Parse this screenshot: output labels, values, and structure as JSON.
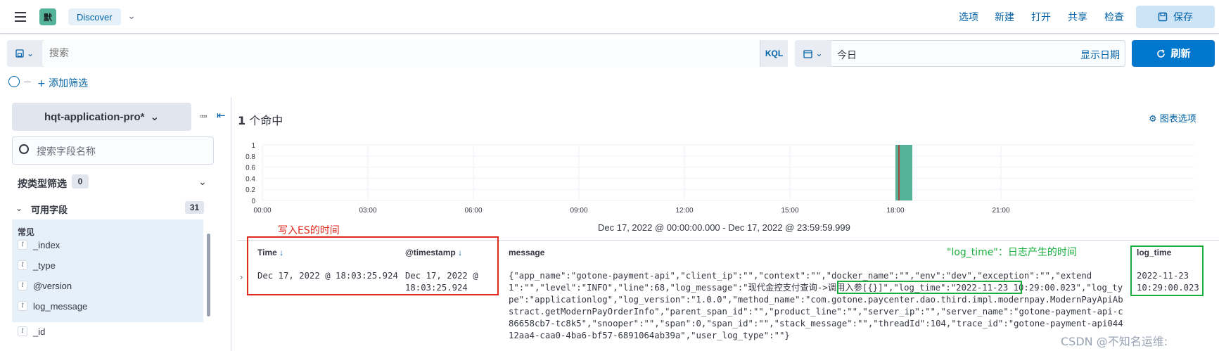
{
  "header": {
    "space_initial": "默",
    "breadcrumb": "Discover",
    "links": [
      "选项",
      "新建",
      "打开",
      "共享",
      "检查"
    ],
    "save_label": "保存"
  },
  "query": {
    "placeholder": "搜索",
    "language": "KQL",
    "date_value": "今日",
    "show_dates": "显示日期",
    "refresh_label": "刷新",
    "add_filter": "+ 添加筛选"
  },
  "sidebar": {
    "index_pattern": "hqt-application-pro*",
    "field_search_placeholder": "搜索字段名称",
    "type_filter_label": "按类型筛选",
    "type_filter_count": "0",
    "available_label": "可用字段",
    "available_count": "31",
    "common_label": "常见",
    "fields": [
      {
        "type": "t",
        "name": "_index"
      },
      {
        "type": "t",
        "name": "_type"
      },
      {
        "type": "t",
        "name": "@version"
      },
      {
        "type": "t",
        "name": "log_message"
      },
      {
        "type": "t",
        "name": "_id"
      }
    ]
  },
  "main": {
    "hits_count": "1",
    "hits_label": "个命中",
    "chart_options": "图表选项",
    "range_label": "Dec 17, 2022 @ 00:00:00.000 - Dec 17, 2022 @ 23:59:59.999"
  },
  "chart_data": {
    "type": "bar",
    "x_ticks": [
      "00:00",
      "03:00",
      "06:00",
      "09:00",
      "12:00",
      "15:00",
      "18:00",
      "21:00"
    ],
    "y_ticks": [
      "1",
      "0.8",
      "0.6",
      "0.4",
      "0.2",
      "0"
    ],
    "ylim": [
      0,
      1
    ],
    "bars": [
      {
        "x": "18:00",
        "value": 1
      }
    ],
    "bar_color": "#54b399"
  },
  "table": {
    "columns": [
      {
        "label": "Time",
        "sort": "↓"
      },
      {
        "label": "@timestamp",
        "sort": "↓"
      },
      {
        "label": "message",
        "sort": ""
      },
      {
        "label": "log_time",
        "sort": ""
      }
    ],
    "row": {
      "time": "Dec 17, 2022 @ 18:03:25.924",
      "timestamp": "Dec 17, 2022 @ 18:03:25.924",
      "message": "{\"app_name\":\"gotone-payment-api\",\"client_ip\":\"\",\"context\":\"\",\"docker_name\":\"\",\"env\":\"dev\",\"exception\":\"\",\"extend1\":\"\",\"level\":\"INFO\",\"line\":68,\"log_message\":\"现代金控支付查询->调用入参[{}]\",\"log_time\":\"2022-11-23 10:29:00.023\",\"log_type\":\"applicationlog\",\"log_version\":\"1.0.0\",\"method_name\":\"com.gotone.paycenter.dao.third.impl.modernpay.ModernPayApiAbstract.getModernPayOrderInfo\",\"parent_span_id\":\"\",\"product_line\":\"\",\"server_ip\":\"\",\"server_name\":\"gotone-payment-api-c86658cb7-tc8k5\",\"snooper\":\"\",\"span\":0,\"span_id\":\"\",\"stack_message\":\"\",\"threadId\":104,\"trace_id\":\"gotone-payment-api04412aa4-caa0-4ba6-bf57-6891064ab39a\",\"user_log_type\":\"\"}",
      "log_time": "2022-11-23 10:29:00.023"
    }
  },
  "annotations": {
    "red_note": "写入ES的时间",
    "green_note": "\"log_time\"：日志产生的时间"
  },
  "watermark": "CSDN @不知名运维:"
}
